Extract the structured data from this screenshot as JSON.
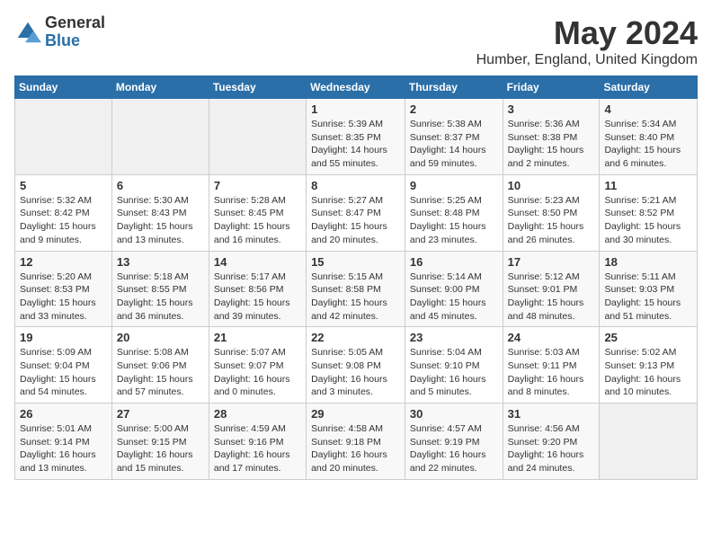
{
  "logo": {
    "general": "General",
    "blue": "Blue"
  },
  "title": "May 2024",
  "subtitle": "Humber, England, United Kingdom",
  "days_of_week": [
    "Sunday",
    "Monday",
    "Tuesday",
    "Wednesday",
    "Thursday",
    "Friday",
    "Saturday"
  ],
  "weeks": [
    [
      {
        "day": "",
        "info": ""
      },
      {
        "day": "",
        "info": ""
      },
      {
        "day": "",
        "info": ""
      },
      {
        "day": "1",
        "info": "Sunrise: 5:39 AM\nSunset: 8:35 PM\nDaylight: 14 hours\nand 55 minutes."
      },
      {
        "day": "2",
        "info": "Sunrise: 5:38 AM\nSunset: 8:37 PM\nDaylight: 14 hours\nand 59 minutes."
      },
      {
        "day": "3",
        "info": "Sunrise: 5:36 AM\nSunset: 8:38 PM\nDaylight: 15 hours\nand 2 minutes."
      },
      {
        "day": "4",
        "info": "Sunrise: 5:34 AM\nSunset: 8:40 PM\nDaylight: 15 hours\nand 6 minutes."
      }
    ],
    [
      {
        "day": "5",
        "info": "Sunrise: 5:32 AM\nSunset: 8:42 PM\nDaylight: 15 hours\nand 9 minutes."
      },
      {
        "day": "6",
        "info": "Sunrise: 5:30 AM\nSunset: 8:43 PM\nDaylight: 15 hours\nand 13 minutes."
      },
      {
        "day": "7",
        "info": "Sunrise: 5:28 AM\nSunset: 8:45 PM\nDaylight: 15 hours\nand 16 minutes."
      },
      {
        "day": "8",
        "info": "Sunrise: 5:27 AM\nSunset: 8:47 PM\nDaylight: 15 hours\nand 20 minutes."
      },
      {
        "day": "9",
        "info": "Sunrise: 5:25 AM\nSunset: 8:48 PM\nDaylight: 15 hours\nand 23 minutes."
      },
      {
        "day": "10",
        "info": "Sunrise: 5:23 AM\nSunset: 8:50 PM\nDaylight: 15 hours\nand 26 minutes."
      },
      {
        "day": "11",
        "info": "Sunrise: 5:21 AM\nSunset: 8:52 PM\nDaylight: 15 hours\nand 30 minutes."
      }
    ],
    [
      {
        "day": "12",
        "info": "Sunrise: 5:20 AM\nSunset: 8:53 PM\nDaylight: 15 hours\nand 33 minutes."
      },
      {
        "day": "13",
        "info": "Sunrise: 5:18 AM\nSunset: 8:55 PM\nDaylight: 15 hours\nand 36 minutes."
      },
      {
        "day": "14",
        "info": "Sunrise: 5:17 AM\nSunset: 8:56 PM\nDaylight: 15 hours\nand 39 minutes."
      },
      {
        "day": "15",
        "info": "Sunrise: 5:15 AM\nSunset: 8:58 PM\nDaylight: 15 hours\nand 42 minutes."
      },
      {
        "day": "16",
        "info": "Sunrise: 5:14 AM\nSunset: 9:00 PM\nDaylight: 15 hours\nand 45 minutes."
      },
      {
        "day": "17",
        "info": "Sunrise: 5:12 AM\nSunset: 9:01 PM\nDaylight: 15 hours\nand 48 minutes."
      },
      {
        "day": "18",
        "info": "Sunrise: 5:11 AM\nSunset: 9:03 PM\nDaylight: 15 hours\nand 51 minutes."
      }
    ],
    [
      {
        "day": "19",
        "info": "Sunrise: 5:09 AM\nSunset: 9:04 PM\nDaylight: 15 hours\nand 54 minutes."
      },
      {
        "day": "20",
        "info": "Sunrise: 5:08 AM\nSunset: 9:06 PM\nDaylight: 15 hours\nand 57 minutes."
      },
      {
        "day": "21",
        "info": "Sunrise: 5:07 AM\nSunset: 9:07 PM\nDaylight: 16 hours\nand 0 minutes."
      },
      {
        "day": "22",
        "info": "Sunrise: 5:05 AM\nSunset: 9:08 PM\nDaylight: 16 hours\nand 3 minutes."
      },
      {
        "day": "23",
        "info": "Sunrise: 5:04 AM\nSunset: 9:10 PM\nDaylight: 16 hours\nand 5 minutes."
      },
      {
        "day": "24",
        "info": "Sunrise: 5:03 AM\nSunset: 9:11 PM\nDaylight: 16 hours\nand 8 minutes."
      },
      {
        "day": "25",
        "info": "Sunrise: 5:02 AM\nSunset: 9:13 PM\nDaylight: 16 hours\nand 10 minutes."
      }
    ],
    [
      {
        "day": "26",
        "info": "Sunrise: 5:01 AM\nSunset: 9:14 PM\nDaylight: 16 hours\nand 13 minutes."
      },
      {
        "day": "27",
        "info": "Sunrise: 5:00 AM\nSunset: 9:15 PM\nDaylight: 16 hours\nand 15 minutes."
      },
      {
        "day": "28",
        "info": "Sunrise: 4:59 AM\nSunset: 9:16 PM\nDaylight: 16 hours\nand 17 minutes."
      },
      {
        "day": "29",
        "info": "Sunrise: 4:58 AM\nSunset: 9:18 PM\nDaylight: 16 hours\nand 20 minutes."
      },
      {
        "day": "30",
        "info": "Sunrise: 4:57 AM\nSunset: 9:19 PM\nDaylight: 16 hours\nand 22 minutes."
      },
      {
        "day": "31",
        "info": "Sunrise: 4:56 AM\nSunset: 9:20 PM\nDaylight: 16 hours\nand 24 minutes."
      },
      {
        "day": "",
        "info": ""
      }
    ]
  ]
}
